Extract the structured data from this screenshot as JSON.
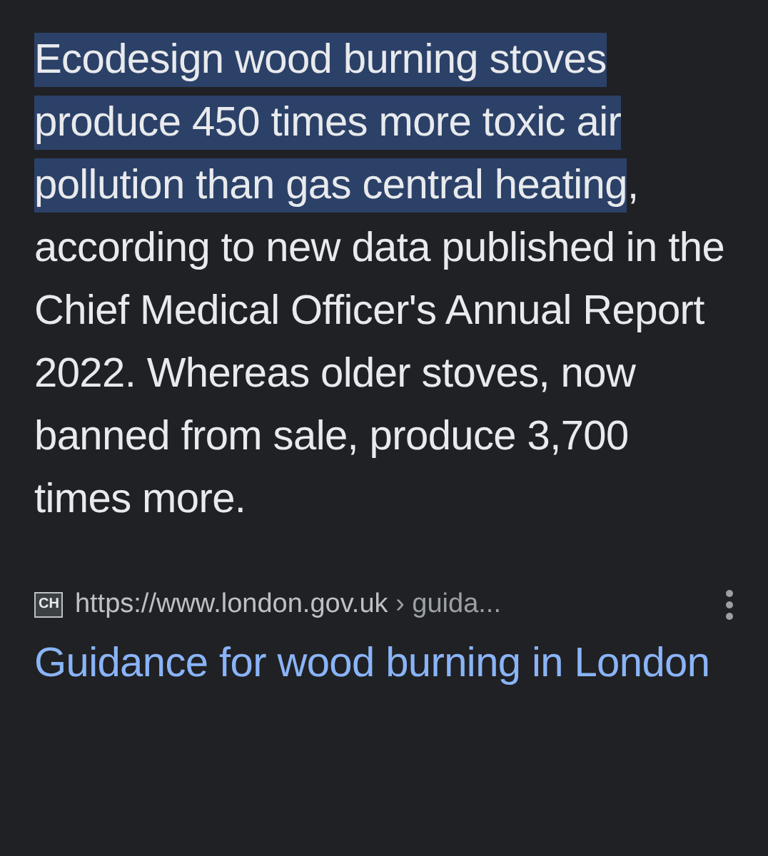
{
  "snippet": {
    "highlighted": "Ecodesign wood burning stoves produce 450 times more toxic air pollution than gas central heating",
    "rest": ", according to new data published in the Chief Medical Officer's Annual Report 2022. Whereas older stoves, now banned from sale, produce 3,700 times more."
  },
  "source": {
    "favicon": "CH",
    "url": "https://www.london.gov.uk",
    "path": "› guida..."
  },
  "result_title": "Guidance for wood burning in London"
}
